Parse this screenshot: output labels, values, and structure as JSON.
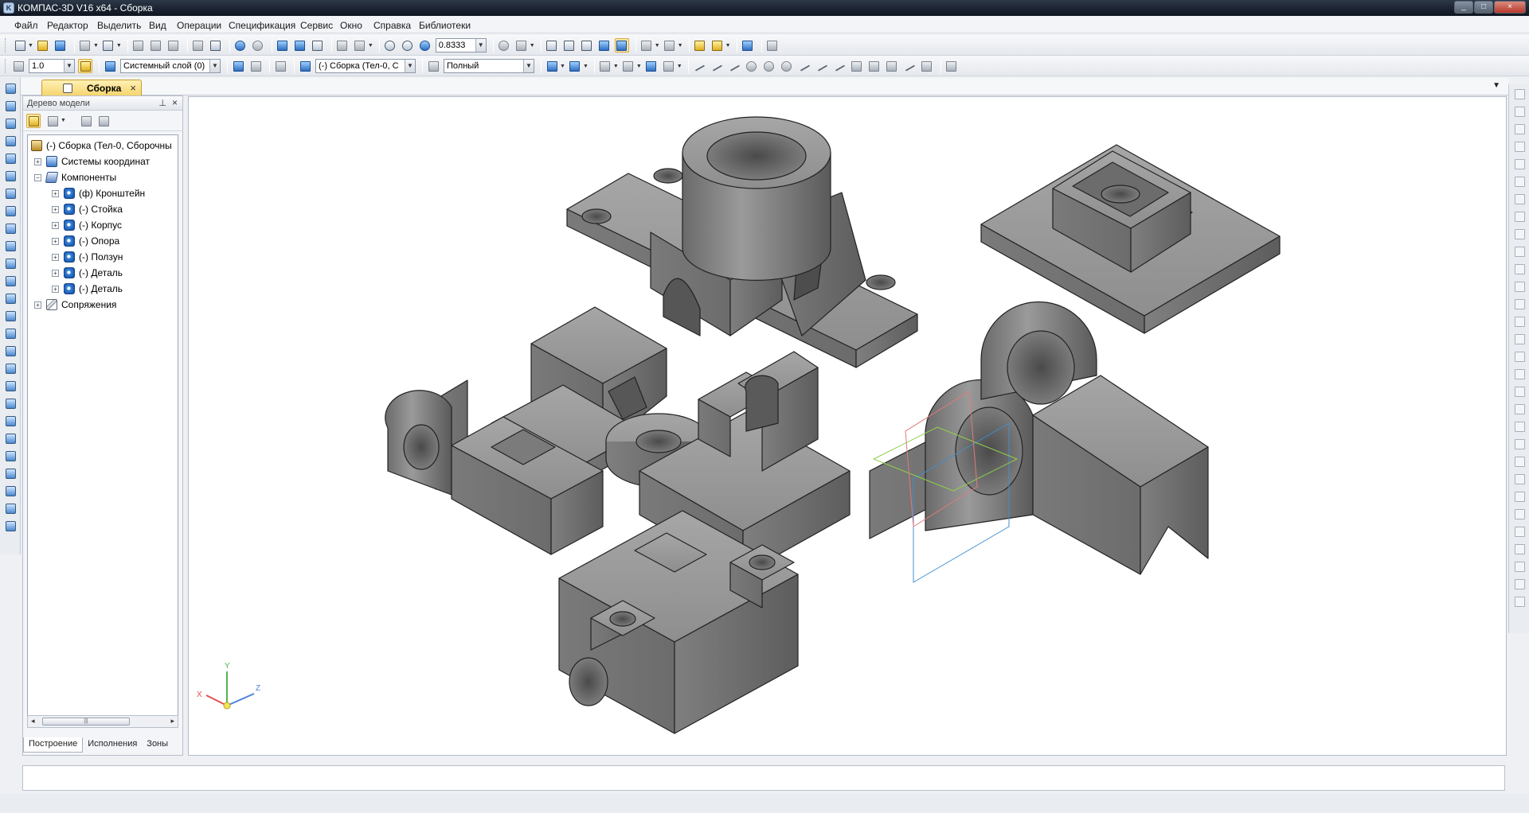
{
  "window": {
    "title": "КОМПАС-3D V16  x64 - Сборка",
    "controls": [
      "_",
      "□",
      "×"
    ]
  },
  "menu": [
    "Файл",
    "Редактор",
    "Выделить",
    "Вид",
    "Операции",
    "Спецификация",
    "Сервис",
    "Окно",
    "Справка",
    "Библиотеки"
  ],
  "toolbar2": {
    "step_value": "1.0",
    "layer_value": "Системный слой (0)",
    "assembly_value": "(-) Сборка (Тел-0, С",
    "view_mode_value": "Полный"
  },
  "toolbar1": {
    "zoom_value": "0.8333"
  },
  "document_tab": {
    "label": "Сборка",
    "close": "×"
  },
  "tree_panel": {
    "title": "Дерево модели",
    "pin": "⊥",
    "close": "×",
    "root": "(-) Сборка (Тел-0, Сборочны",
    "nodes": [
      {
        "label": "Системы координат",
        "type": "csys",
        "level": 1,
        "expander": "+"
      },
      {
        "label": "Компоненты",
        "type": "comp",
        "level": 1,
        "expander": "−"
      },
      {
        "label": "(ф) Кронштейн",
        "type": "part",
        "level": 2,
        "expander": "+"
      },
      {
        "label": "(-) Стойка",
        "type": "part",
        "level": 2,
        "expander": "+"
      },
      {
        "label": "(-) Корпус",
        "type": "part",
        "level": 2,
        "expander": "+"
      },
      {
        "label": "(-) Опора",
        "type": "part",
        "level": 2,
        "expander": "+"
      },
      {
        "label": "(-) Ползун",
        "type": "part",
        "level": 2,
        "expander": "+"
      },
      {
        "label": "(-) Деталь",
        "type": "part",
        "level": 2,
        "expander": "+"
      },
      {
        "label": "(-) Деталь",
        "type": "part",
        "level": 2,
        "expander": "+"
      },
      {
        "label": "Сопряжения",
        "type": "mate",
        "level": 1,
        "expander": "+"
      }
    ],
    "tabs": [
      "Построение",
      "Исполнения",
      "Зоны"
    ]
  },
  "triad": {
    "x": "X",
    "y": "Y",
    "z": "Z"
  },
  "colors": {
    "accent_tab": "#f5d36a",
    "part_fill": "#8a8a8a",
    "title_bar": "#1a2230"
  }
}
